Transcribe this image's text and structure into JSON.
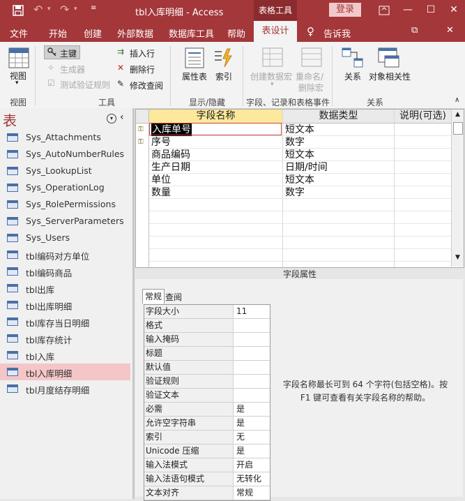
{
  "titlebar": {
    "title": "tbl入库明细 - Access",
    "context_tab": "表格工具",
    "login": "登录"
  },
  "menu": [
    "文件",
    "开始",
    "创建",
    "外部数据",
    "数据库工具",
    "帮助",
    "表设计",
    "告诉我"
  ],
  "ribbon": {
    "view": "视图",
    "primary_key": "主键",
    "builder": "生成器",
    "test_rules": "测试验证规则",
    "insert_row": "插入行",
    "delete_row": "删除行",
    "modify_lookup": "修改查阅",
    "property_sheet": "属性表",
    "indexes": "索引",
    "create_macro": "创建数据宏",
    "rename_delete_macro_1": "重命名/",
    "rename_delete_macro_2": "删除宏",
    "relationships": "关系",
    "object_dependencies": "对象相关性",
    "groups": [
      "视图",
      "工具",
      "显示/隐藏",
      "字段、记录和表格事件",
      "关系"
    ]
  },
  "nav": {
    "title": "表",
    "items": [
      "Sys_Attachments",
      "Sys_AutoNumberRules",
      "Sys_LookupList",
      "Sys_OperationLog",
      "Sys_RolePermissions",
      "Sys_ServerParameters",
      "Sys_Users",
      "tbl编码对方单位",
      "tbl编码商品",
      "tbl出库",
      "tbl出库明细",
      "tbl库存当日明细",
      "tbl库存统计",
      "tbl入库",
      "tbl入库明细",
      "tbl月度结存明细"
    ],
    "selected_index": 14
  },
  "grid": {
    "headers": [
      "字段名称",
      "数据类型",
      "说明(可选)"
    ],
    "rows": [
      {
        "name": "入库单号",
        "type": "短文本",
        "key": true
      },
      {
        "name": "序号",
        "type": "数字",
        "key": true
      },
      {
        "name": "商品编码",
        "type": "短文本",
        "key": false
      },
      {
        "name": "生产日期",
        "type": "日期/时间",
        "key": false
      },
      {
        "name": "单位",
        "type": "短文本",
        "key": false
      },
      {
        "name": "数量",
        "type": "数字",
        "key": false
      }
    ]
  },
  "field_properties": {
    "label": "字段属性",
    "tabs": [
      "常规",
      "查阅"
    ],
    "props": [
      {
        "name": "字段大小",
        "value": "11"
      },
      {
        "name": "格式",
        "value": ""
      },
      {
        "name": "输入掩码",
        "value": ""
      },
      {
        "name": "标题",
        "value": ""
      },
      {
        "name": "默认值",
        "value": ""
      },
      {
        "name": "验证规则",
        "value": ""
      },
      {
        "name": "验证文本",
        "value": ""
      },
      {
        "name": "必需",
        "value": "是"
      },
      {
        "name": "允许空字符串",
        "value": "是"
      },
      {
        "name": "索引",
        "value": "无"
      },
      {
        "name": "Unicode 压缩",
        "value": "是"
      },
      {
        "name": "输入法模式",
        "value": "开启"
      },
      {
        "name": "输入法语句模式",
        "value": "无转化"
      },
      {
        "name": "文本对齐",
        "value": "常规"
      }
    ],
    "help_line1": "字段名称最长可到 64 个字符(包括空格)。按",
    "help_line2": "F1 键可查看有关字段名称的帮助。"
  }
}
